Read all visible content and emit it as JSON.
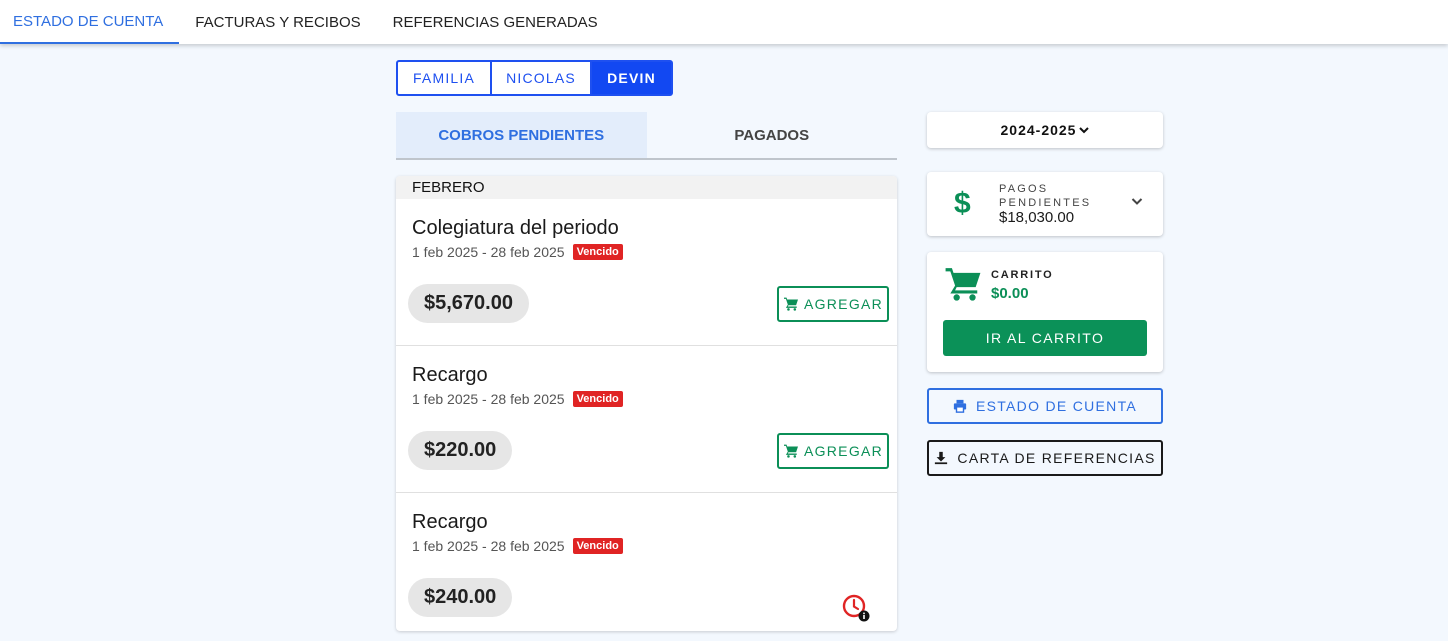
{
  "topnav": {
    "tabs": [
      {
        "label": "ESTADO DE CUENTA",
        "active": true
      },
      {
        "label": "FACTURAS Y RECIBOS",
        "active": false
      },
      {
        "label": "REFERENCIAS GENERADAS",
        "active": false
      }
    ]
  },
  "students": {
    "options": [
      "FAMILIA",
      "NICOLAS",
      "DEVIN"
    ],
    "selected": "DEVIN"
  },
  "status_tabs": {
    "pending_label": "COBROS PENDIENTES",
    "paid_label": "PAGADOS",
    "selected": "COBROS PENDIENTES"
  },
  "charges": {
    "month": "FEBRERO",
    "items": [
      {
        "title": "Colegiatura del periodo",
        "period": "1 feb 2025 - 28 feb 2025",
        "status": "Vencido",
        "amount": "$5,670.00",
        "action": "AGREGAR"
      },
      {
        "title": "Recargo",
        "period": "1 feb 2025 - 28 feb 2025",
        "status": "Vencido",
        "amount": "$220.00",
        "action": "AGREGAR"
      },
      {
        "title": "Recargo",
        "period": "1 feb 2025 - 28 feb 2025",
        "status": "Vencido",
        "amount": "$240.00",
        "action": ""
      }
    ]
  },
  "sidebar": {
    "year": "2024-2025",
    "pending": {
      "label": "PAGOS PENDIENTES",
      "value": "$18,030.00"
    },
    "cart": {
      "label": "CARRITO",
      "value": "$0.00",
      "button": "IR AL CARRITO"
    },
    "account_statement_button": "ESTADO DE CUENTA",
    "references_button": "CARTA DE REFERENCIAS"
  },
  "colors": {
    "accent_blue": "#2f6fe0",
    "toggle_blue": "#1248f2",
    "green": "#0b8f57",
    "overdue_red": "#e02424",
    "background": "#f3f8fe"
  },
  "icons": [
    "cart-icon",
    "clock-info-icon",
    "dollar-icon",
    "chevron-down-icon",
    "printer-icon",
    "download-icon"
  ]
}
